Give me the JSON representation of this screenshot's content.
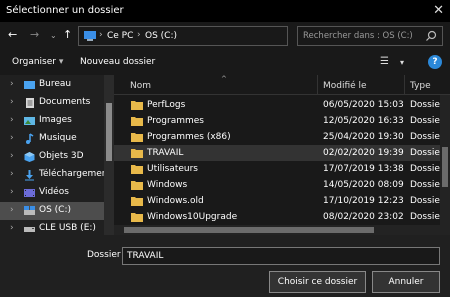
{
  "window": {
    "title": "Sélectionner un dossier"
  },
  "nav": {
    "path": [
      "Ce PC",
      "OS (C:)"
    ],
    "search_placeholder": "Rechercher dans : OS (C:)"
  },
  "toolbar": {
    "organize": "Organiser",
    "new_folder": "Nouveau dossier"
  },
  "sidebar": {
    "items": [
      {
        "label": "Bureau",
        "icon": "desktop-icon"
      },
      {
        "label": "Documents",
        "icon": "documents-icon"
      },
      {
        "label": "Images",
        "icon": "images-icon"
      },
      {
        "label": "Musique",
        "icon": "music-icon"
      },
      {
        "label": "Objets 3D",
        "icon": "objects-3d-icon"
      },
      {
        "label": "Téléchargements",
        "icon": "downloads-icon"
      },
      {
        "label": "Vidéos",
        "icon": "videos-icon"
      },
      {
        "label": "OS (C:)",
        "icon": "drive-icon",
        "selected": true
      },
      {
        "label": "CLE USB (E:)",
        "icon": "usb-drive-icon"
      }
    ]
  },
  "filelist": {
    "columns": [
      "Nom",
      "Modifié le",
      "Type"
    ],
    "rows": [
      {
        "name": "PerfLogs",
        "date": "06/05/2020 15:03",
        "type": "Dossier"
      },
      {
        "name": "Programmes",
        "date": "12/05/2020 16:33",
        "type": "Dossier"
      },
      {
        "name": "Programmes (x86)",
        "date": "25/04/2020 19:30",
        "type": "Dossier"
      },
      {
        "name": "TRAVAIL",
        "date": "02/02/2020 19:39",
        "type": "Dossier",
        "selected": true
      },
      {
        "name": "Utilisateurs",
        "date": "17/07/2019 13:38",
        "type": "Dossier"
      },
      {
        "name": "Windows",
        "date": "14/05/2020 08:09",
        "type": "Dossier"
      },
      {
        "name": "Windows.old",
        "date": "17/10/2019 12:23",
        "type": "Dossier"
      },
      {
        "name": "Windows10Upgrade",
        "date": "08/02/2020 23:02",
        "type": "Dossier"
      }
    ]
  },
  "footer": {
    "folder_label": "Dossier :",
    "folder_value": "TRAVAIL",
    "select_button": "Choisir ce dossier",
    "cancel_button": "Annuler"
  },
  "colors": {
    "folder": "#e8b94a",
    "accent": "#2b88d8",
    "selection": "#4d4d4d"
  }
}
